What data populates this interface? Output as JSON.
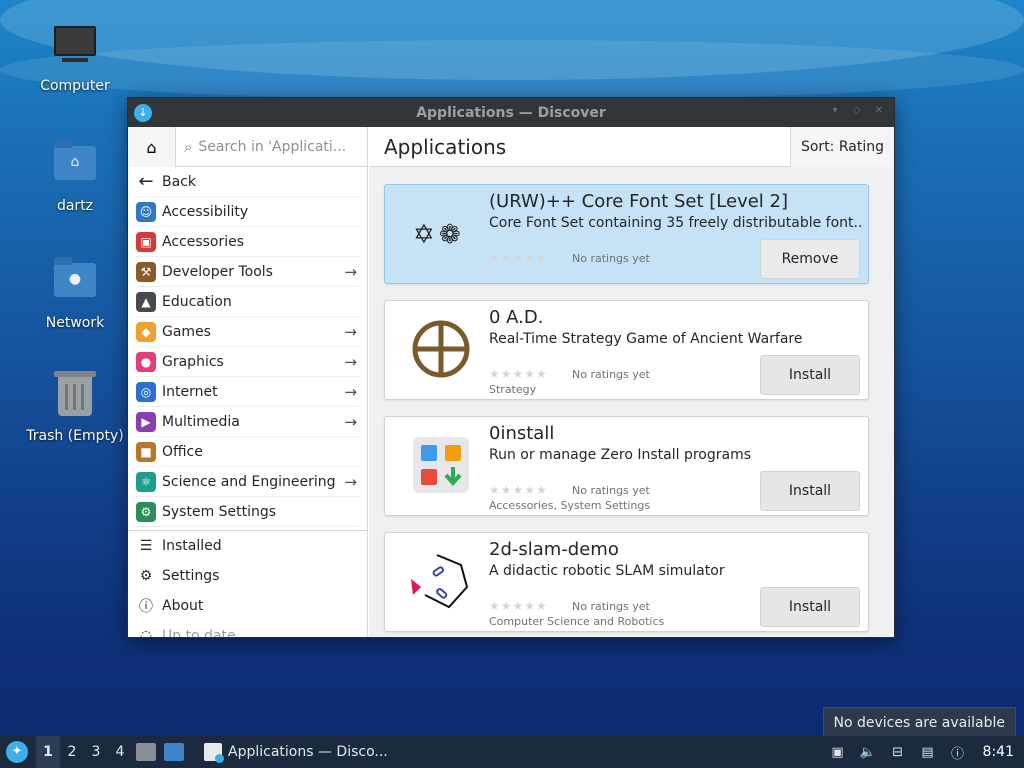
{
  "desktop": {
    "icons": [
      {
        "label": "Computer",
        "icon": "computer-icon"
      },
      {
        "label": "dartz",
        "icon": "home-folder-icon"
      },
      {
        "label": "Network",
        "icon": "network-folder-icon"
      },
      {
        "label": "Trash (Empty)",
        "icon": "trash-icon"
      }
    ]
  },
  "window": {
    "title": "Applications — Discover",
    "sidebar": {
      "search_placeholder": "Search in 'Applicati...",
      "back_label": "Back",
      "categories": [
        {
          "label": "Accessibility",
          "icon": "accessibility-icon",
          "color": "#2f78c5",
          "has_submenu": false
        },
        {
          "label": "Accessories",
          "icon": "toolbox-icon",
          "color": "#d23b3b",
          "has_submenu": false
        },
        {
          "label": "Developer Tools",
          "icon": "hammer-icon",
          "color": "#8a5a2b",
          "has_submenu": true
        },
        {
          "label": "Education",
          "icon": "graduation-cap-icon",
          "color": "#444a50",
          "has_submenu": false
        },
        {
          "label": "Games",
          "icon": "gamepad-icon",
          "color": "#f0a030",
          "has_submenu": true
        },
        {
          "label": "Graphics",
          "icon": "palette-icon",
          "color": "#e0407a",
          "has_submenu": true
        },
        {
          "label": "Internet",
          "icon": "globe-icon",
          "color": "#2c6fd1",
          "has_submenu": true
        },
        {
          "label": "Multimedia",
          "icon": "multimedia-icon",
          "color": "#8a3fb0",
          "has_submenu": true
        },
        {
          "label": "Office",
          "icon": "briefcase-icon",
          "color": "#b8772a",
          "has_submenu": false
        },
        {
          "label": "Science and Engineering",
          "icon": "atom-icon",
          "color": "#1f9c8e",
          "has_submenu": true
        },
        {
          "label": "System Settings",
          "icon": "settings-shield-icon",
          "color": "#2a8f5a",
          "has_submenu": false
        }
      ],
      "bottom_items": [
        {
          "label": "Installed",
          "icon": "list-icon"
        },
        {
          "label": "Settings",
          "icon": "gear-icon"
        },
        {
          "label": "About",
          "icon": "info-icon"
        },
        {
          "label": "Up to date",
          "icon": "update-icon"
        }
      ]
    },
    "main": {
      "page_title": "Applications",
      "sort_label": "Sort: Rating",
      "apps": [
        {
          "name": "(URW)++ Core Font Set [Level 2]",
          "summary": "Core Font Set containing 35 freely distributable font...",
          "rating_text": "No ratings yet",
          "category": "",
          "action": "Remove",
          "selected": true,
          "icon": "font-glyphs-icon"
        },
        {
          "name": "0 A.D.",
          "summary": "Real-Time Strategy Game of Ancient Warfare",
          "rating_text": "No ratings yet",
          "category": "Strategy",
          "action": "Install",
          "selected": false,
          "icon": "0ad-shield-icon"
        },
        {
          "name": "0install",
          "summary": "Run or manage Zero Install programs",
          "rating_text": "No ratings yet",
          "category": "Accessories, System Settings",
          "action": "Install",
          "selected": false,
          "icon": "zero-install-icon"
        },
        {
          "name": "2d-slam-demo",
          "summary": "A didactic robotic SLAM simulator",
          "rating_text": "No ratings yet",
          "category": "Computer Science and Robotics",
          "action": "Install",
          "selected": false,
          "icon": "robot-slam-icon"
        }
      ]
    }
  },
  "taskbar": {
    "workspaces": [
      "1",
      "2",
      "3",
      "4"
    ],
    "active_workspace": "1",
    "task_label": "Applications — Disco...",
    "clock": "8:41",
    "tooltip": "No devices are available"
  },
  "colors": {
    "accent": "#3daee9",
    "selected_card": "#c5e2f7",
    "titlebar": "#31363b",
    "taskbar": "#1c2a3f"
  }
}
